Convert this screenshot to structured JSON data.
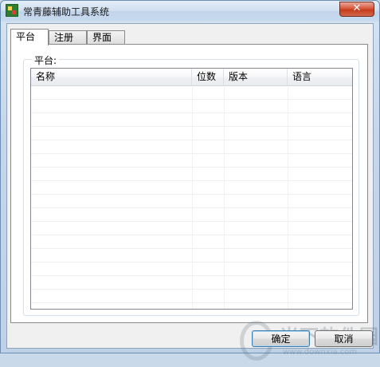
{
  "window": {
    "title": "常青藤辅助工具系统",
    "close_label": "✕"
  },
  "tabs": [
    {
      "label": "平台",
      "active": true
    },
    {
      "label": "注册",
      "active": false
    },
    {
      "label": "界面",
      "active": false
    }
  ],
  "group": {
    "label": "平台:"
  },
  "list": {
    "columns": [
      "名称",
      "位数",
      "版本",
      "语言"
    ],
    "rows": []
  },
  "buttons": {
    "ok": "确定",
    "cancel": "取消"
  },
  "watermark": {
    "text": "当下软件园",
    "url": "www.downxia.com"
  }
}
